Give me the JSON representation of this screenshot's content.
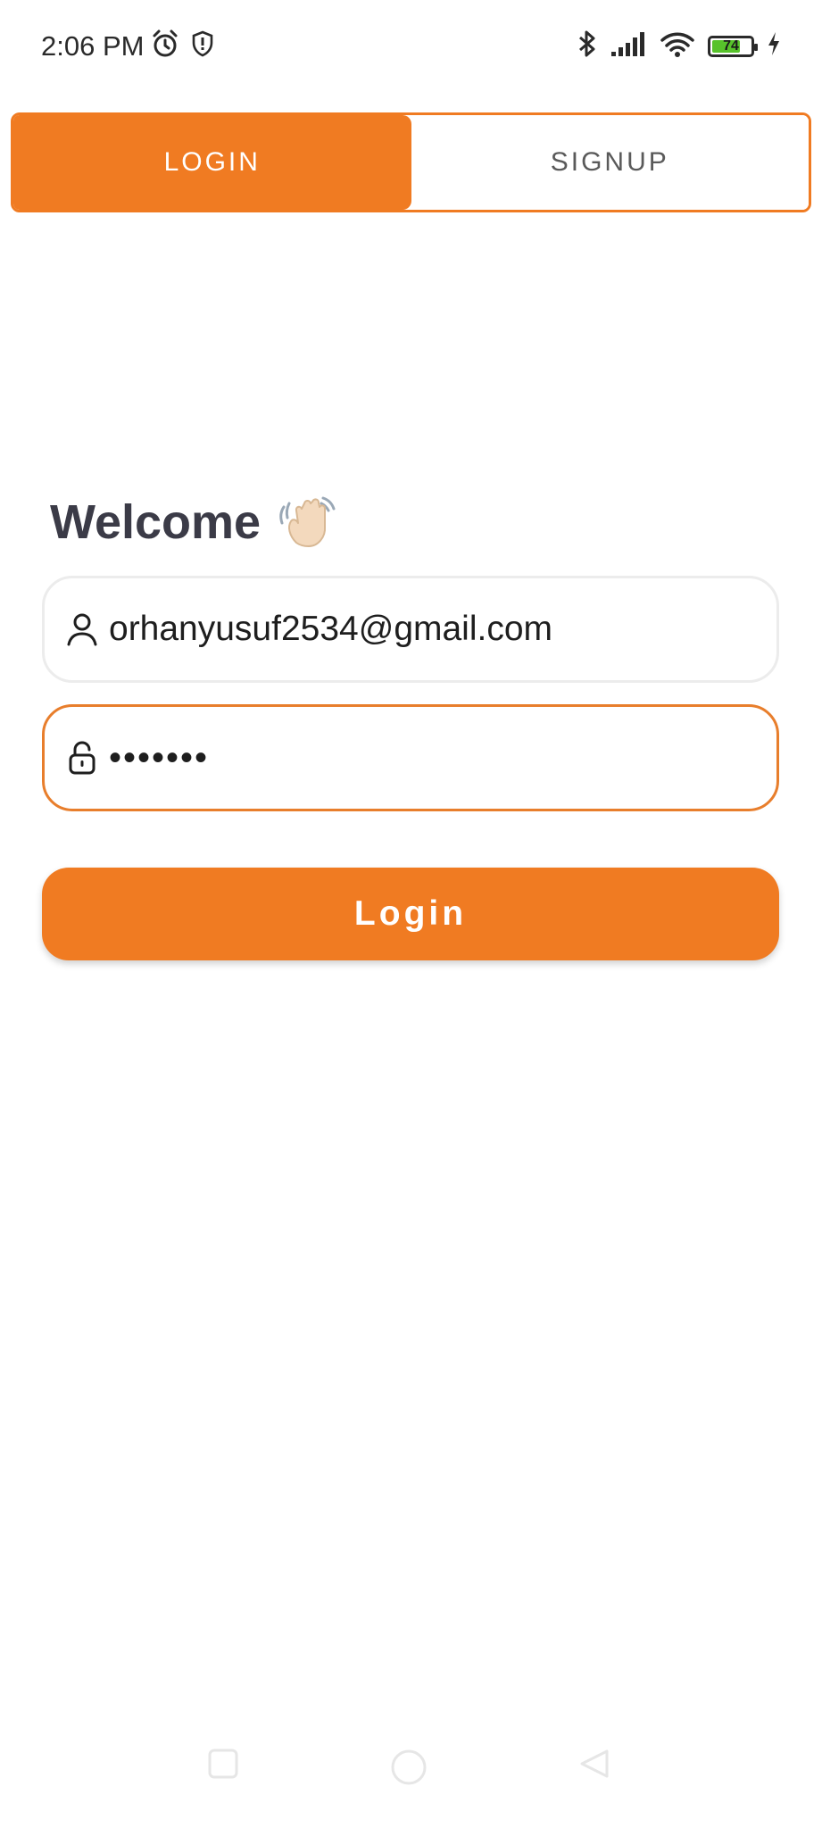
{
  "status_bar": {
    "time": "2:06 PM",
    "left_icons": [
      "alarm-icon",
      "shield-icon"
    ],
    "right_icons": [
      "bluetooth-icon",
      "signal-icon",
      "wifi-icon",
      "battery-icon",
      "charging-icon"
    ],
    "battery_level": "74",
    "battery_color": "#57c22b"
  },
  "tabs": [
    {
      "label": "LOGIN",
      "active": true
    },
    {
      "label": "SIGNUP",
      "active": false
    }
  ],
  "welcome": {
    "title": "Welcome",
    "icon": "waving-hand-icon"
  },
  "form": {
    "email": {
      "value": "orhanyusuf2534@gmail.com",
      "icon": "user-icon"
    },
    "password": {
      "value": "•••••••",
      "icon": "lock-icon"
    },
    "submit_label": "Login"
  },
  "nav_bar": {
    "buttons": [
      "recent-apps-icon",
      "home-icon",
      "back-icon"
    ]
  },
  "colors": {
    "accent": "#f07b22",
    "text_dark": "#3b3b47"
  }
}
